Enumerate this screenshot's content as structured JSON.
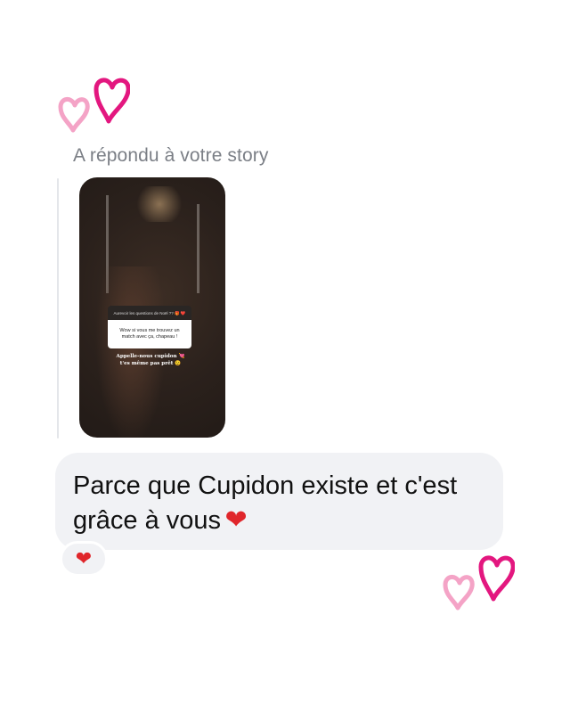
{
  "reply": {
    "caption": "A répondu à votre story"
  },
  "story_preview": {
    "question_sticker": "Aurevoir les questions de Noël ?? 🎁 ❤️",
    "answer_text": "Wow si vous me trouvez un match avec ça, chapeau !",
    "overlay_line1": "Appelle-nous cupidon 💘",
    "overlay_line2": "t'es même pas prêt 😉"
  },
  "message": {
    "text": "Parce que Cupidon existe et c'est grâce à vous",
    "emoji": "❤"
  },
  "reaction": {
    "emoji": "❤"
  },
  "colors": {
    "heart_magenta": "#e3177f",
    "heart_pink": "#f4a3c6",
    "bubble_bg": "#f1f2f5",
    "caption_gray": "#7b7f86",
    "heart_red": "#e0262b"
  },
  "icons": {
    "top_decoration": "double-heart-icon",
    "bottom_decoration": "double-heart-icon",
    "reaction": "red-heart-icon"
  }
}
